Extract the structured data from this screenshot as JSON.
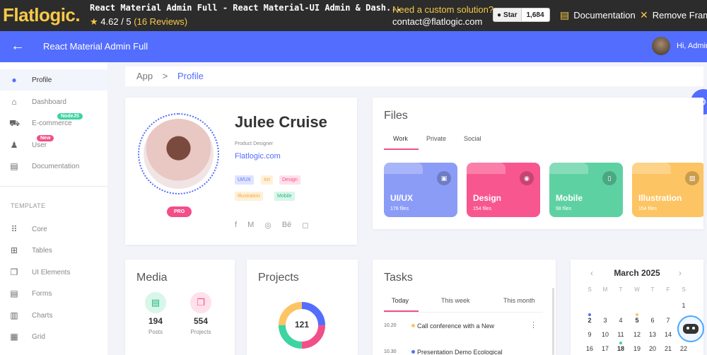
{
  "topbar": {
    "brand": "Flatlogic",
    "brand_dot": ".",
    "product_title": "React Material Admin Full - React Material-UI Admin & Dash...",
    "rating_star": "★",
    "rating": "4.62 / 5",
    "reviews": "(16 Reviews)",
    "custom_q": "Need a custom solution?",
    "contact": "contact@flatlogic.com",
    "github_star_label": "Star",
    "github_count": "1,684",
    "documentation": "Documentation",
    "remove_frame": "Remove Frame"
  },
  "header": {
    "title": "React Material Admin Full",
    "greeting": "Hi, Admin"
  },
  "sidebar": {
    "items": [
      {
        "label": "Profile",
        "icon": "person-icon",
        "glyph": "●"
      },
      {
        "label": "Dashboard",
        "icon": "home-icon",
        "glyph": "⌂"
      },
      {
        "label": "E-commerce",
        "icon": "cart-icon",
        "glyph": "⛟"
      },
      {
        "label": "User",
        "icon": "user-icon",
        "glyph": "♟"
      },
      {
        "label": "Documentation",
        "icon": "document-icon",
        "glyph": "▤"
      }
    ],
    "badges": {
      "ecommerce": "NodeJS",
      "user": "New"
    },
    "section_label": "TEMPLATE",
    "template_items": [
      {
        "label": "Core",
        "icon": "grid-dots-icon",
        "glyph": "⠿"
      },
      {
        "label": "Tables",
        "icon": "table-icon",
        "glyph": "⊞"
      },
      {
        "label": "UI Elements",
        "icon": "layers-icon",
        "glyph": "❐"
      },
      {
        "label": "Forms",
        "icon": "form-icon",
        "glyph": "▤"
      },
      {
        "label": "Charts",
        "icon": "bar-chart-icon",
        "glyph": "▥"
      },
      {
        "label": "Grid",
        "icon": "grid-icon",
        "glyph": "▦"
      }
    ]
  },
  "breadcrumb": {
    "root": "App",
    "separator": ">",
    "current": "Profile"
  },
  "profile": {
    "name": "Julee Cruise",
    "role": "Product Designer",
    "site": "Flatlogic.com",
    "pro": "PRO",
    "tags": [
      "UI/UX",
      "Art",
      "Design",
      "Illustration",
      "Mobile"
    ],
    "socials": [
      "f",
      "M",
      "◎",
      "Bē",
      "◻"
    ]
  },
  "files": {
    "title": "Files",
    "tabs": [
      "Work",
      "Private",
      "Social"
    ],
    "folders": [
      {
        "label": "UI/UX",
        "count": "178 files",
        "color": "#8b9cf7",
        "icon": "window-icon",
        "glyph": "▣"
      },
      {
        "label": "Design",
        "count": "154 files",
        "color": "#f8568e",
        "icon": "eye-icon",
        "glyph": "◉"
      },
      {
        "label": "Mobile",
        "count": "98 files",
        "color": "#5ed1a2",
        "icon": "phone-icon",
        "glyph": "▯"
      },
      {
        "label": "Illustration",
        "count": "154 files",
        "color": "#fcc463",
        "icon": "image-icon",
        "glyph": "▨"
      }
    ]
  },
  "media": {
    "title": "Media",
    "posts": {
      "value": "194",
      "label": "Posts"
    },
    "projects": {
      "value": "554",
      "label": "Projects"
    }
  },
  "projects": {
    "title": "Projects",
    "total": "121"
  },
  "tasks": {
    "title": "Tasks",
    "tabs": [
      "Today",
      "This week",
      "This month"
    ],
    "items": [
      {
        "time": "10.20",
        "text": "Call conference with a New",
        "color": "#fcc463"
      },
      {
        "time": "10.30",
        "text": "Presentation Demo Ecological",
        "color": "#536dfe"
      }
    ]
  },
  "calendar": {
    "month": "March 2025",
    "prev": "‹",
    "next": "›",
    "dow": [
      "S",
      "M",
      "T",
      "W",
      "T",
      "F",
      "S"
    ],
    "rows": [
      [
        "",
        "",
        "",
        "",
        "",
        "",
        "1"
      ],
      [
        "2",
        "3",
        "4",
        "5",
        "6",
        "7",
        "8"
      ],
      [
        "9",
        "10",
        "11",
        "12",
        "13",
        "14",
        "15"
      ],
      [
        "16",
        "17",
        "18",
        "19",
        "20",
        "21",
        "22"
      ]
    ]
  },
  "colors": {
    "primary": "#536dfe",
    "pink": "#f24f88",
    "yellow": "#f7c948",
    "green": "#5ed1a2"
  }
}
